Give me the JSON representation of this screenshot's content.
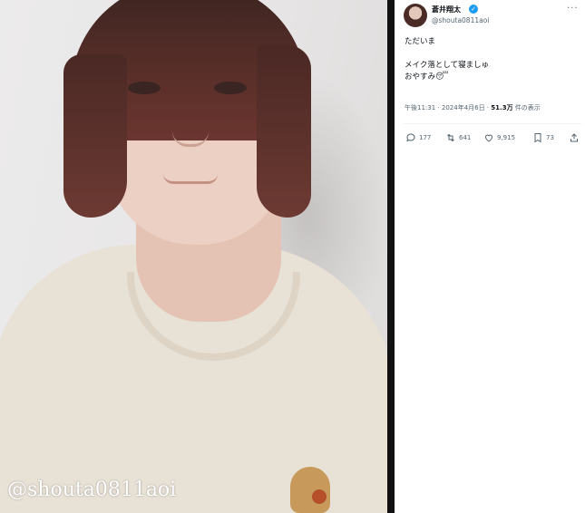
{
  "photo": {
    "watermark": "@shouta0811aoi"
  },
  "tweet": {
    "author_name": "蒼井翔太",
    "handle": "@shouta0811aoi",
    "verified_glyph": "✓",
    "more_glyph": "···",
    "body_lines": [
      "ただいま",
      "",
      "メイク落として寝ましゅ",
      "おやすみ"
    ],
    "sleepy_emoji": "😴",
    "meta": {
      "time": "午後11:31",
      "separator": " · ",
      "date": "2024年4月6日",
      "views_count": "51.3万",
      "views_suffix": " 件の表示"
    },
    "actions": {
      "reply": "177",
      "retweet": "641",
      "like": "9,915",
      "bookmark": "73"
    },
    "colors": {
      "accent": "#1d9bf0",
      "text": "#0f1419",
      "muted": "#536471"
    },
    "icons": [
      "reply-icon",
      "retweet-icon",
      "like-icon",
      "bookmark-icon",
      "share-icon"
    ]
  }
}
